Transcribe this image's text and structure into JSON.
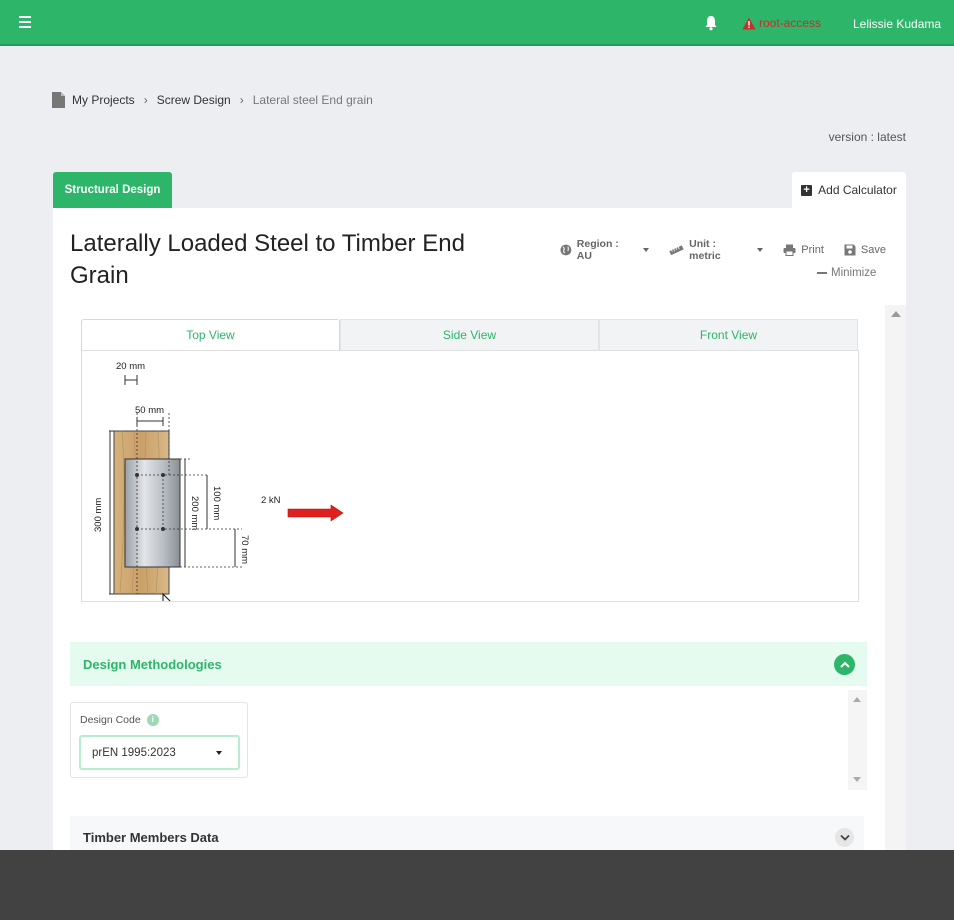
{
  "header": {
    "alert_label": "root-access",
    "user_name": "Lelissie Kudama",
    "accent_color": "#2db56a"
  },
  "breadcrumb": {
    "items": [
      "My Projects",
      "Screw Design",
      "Lateral steel End grain"
    ]
  },
  "version_text": "version : latest",
  "tabs": {
    "structural_design": "Structural Design",
    "add_calculator": "Add Calculator"
  },
  "page": {
    "title": "Laterally Loaded Steel to Timber End Grain"
  },
  "toolbar": {
    "region": "Region : AU",
    "unit": "Unit : metric",
    "print": "Print",
    "save": "Save",
    "minimize": "Minimize"
  },
  "views": {
    "tabs": [
      "Top View",
      "Side View",
      "Front View"
    ],
    "active": "Top View"
  },
  "drawing": {
    "dim_edge": "20 mm",
    "dim_width": "50 mm",
    "dim_height": "300 mm",
    "dim_spacing": "100 mm",
    "dim_inner": "200 mm",
    "dim_end": "70 mm",
    "load": "2 kN"
  },
  "methodologies": {
    "title": "Design Methodologies",
    "design_code_label": "Design Code",
    "design_code_value": "prEN 1995:2023",
    "info_glyph": "i"
  },
  "timber_members": {
    "title": "Timber Members Data"
  }
}
